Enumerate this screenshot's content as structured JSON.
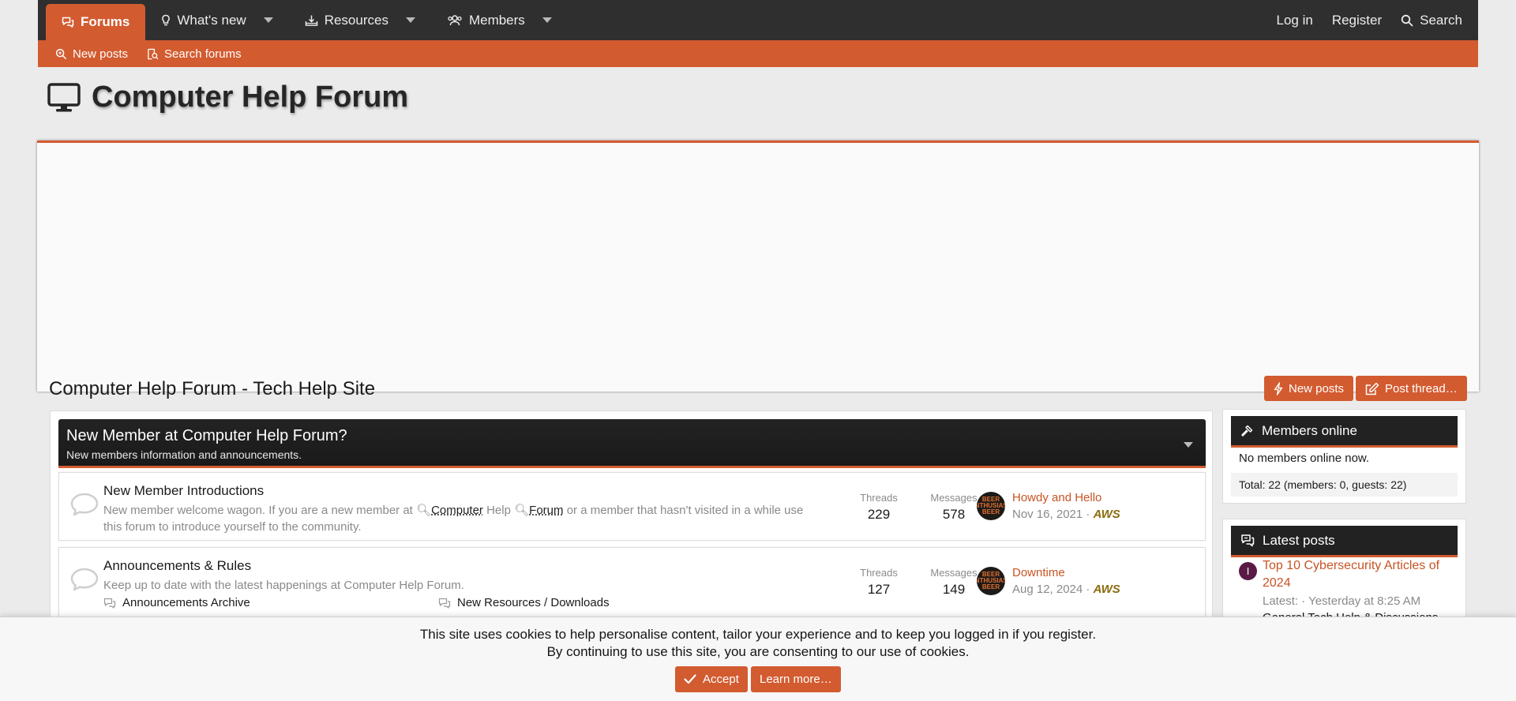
{
  "nav": {
    "forums": "Forums",
    "whats_new": "What's new",
    "resources": "Resources",
    "members": "Members",
    "login": "Log in",
    "register": "Register",
    "search": "Search"
  },
  "subnav": {
    "new_posts": "New posts",
    "search_forums": "Search forums"
  },
  "page": {
    "title": "Computer Help Forum",
    "subtitle": "Computer Help Forum - Tech Help Site",
    "new_posts_button": "New posts",
    "post_thread_button": "Post thread…"
  },
  "category": {
    "title": "New Member at Computer Help Forum?",
    "description": "New members information and announcements."
  },
  "nodes": [
    {
      "title": "New Member Introductions",
      "desc_prefix": "New member welcome wagon. If you are a new member at",
      "kw1": "Computer",
      "desc_mid": "Help",
      "kw2": "Forum",
      "desc_line1_end": "or a member that hasn't visited in a while use",
      "desc_line2": "this forum to introduce yourself to the community.",
      "threads_label": "Threads",
      "threads": "229",
      "messages_label": "Messages",
      "messages": "578",
      "last_title": "Howdy and Hello",
      "last_date": "Nov 16, 2021 ·",
      "last_user": "AWS"
    },
    {
      "title": "Announcements & Rules",
      "desc": "Keep up to date with the latest happenings at Computer Help Forum.",
      "threads_label": "Threads",
      "threads": "127",
      "messages_label": "Messages",
      "messages": "149",
      "last_title": "Downtime",
      "last_date": "Aug 12, 2024 ·",
      "last_user": "AWS",
      "sub_forums": [
        "Announcements Archive",
        "New Resources / Downloads"
      ]
    }
  ],
  "avatar_text": "BEER ENTHUSIAST BEER",
  "members_online": {
    "title": "Members online",
    "status": "No members online now.",
    "total": "Total: 22 (members: 0, guests: 22)"
  },
  "latest_posts": {
    "title": "Latest posts",
    "avatar_letter": "I",
    "post_title_line1": "Top 10 Cybersecurity Articles of",
    "post_title_line2": "2024",
    "post_meta": "Latest: · Yesterday at 8:25 AM",
    "post_forum": "General Tech Help & Discussions"
  },
  "cookie": {
    "line1": "This site uses cookies to help personalise content, tailor your experience and to keep you logged in if you register.",
    "line2": "By continuing to use this site, you are consenting to our use of cookies.",
    "accept": "Accept",
    "learn_more": "Learn more…"
  },
  "colors": {
    "accent": "#d35b30",
    "nav_bg": "#2f2f2f",
    "page_bg": "#ebebeb",
    "link": "#c75424",
    "username": "#8b6d10"
  }
}
